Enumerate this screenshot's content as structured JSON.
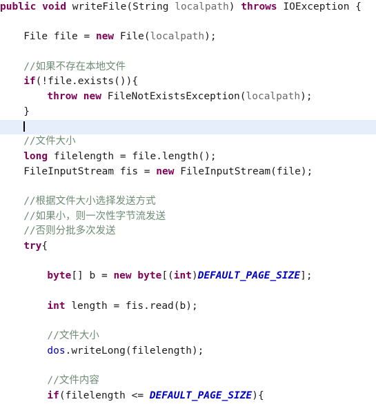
{
  "editor": {
    "language": "java",
    "theme": {
      "background": "#ffffff",
      "foreground": "#1a1a1a",
      "keyword": "#7f0055",
      "comment": "#6e8b74",
      "parameter": "#6a6a6a",
      "field": "#0000c0",
      "static_constant": "#0000c0",
      "current_line_highlight": "#e6eefb",
      "caret": "#000000"
    },
    "caret_line_index": 7,
    "lines": [
      {
        "indent": 0,
        "tokens": [
          {
            "t": "public",
            "c": "kw"
          },
          {
            "t": " ",
            "c": "plain"
          },
          {
            "t": "void",
            "c": "kw"
          },
          {
            "t": " ",
            "c": "plain"
          },
          {
            "t": "writeFile",
            "c": "plain"
          },
          {
            "t": "(",
            "c": "punc"
          },
          {
            "t": "String",
            "c": "plain"
          },
          {
            "t": " ",
            "c": "plain"
          },
          {
            "t": "localpath",
            "c": "param"
          },
          {
            "t": ") ",
            "c": "punc"
          },
          {
            "t": "throws",
            "c": "kw"
          },
          {
            "t": " ",
            "c": "plain"
          },
          {
            "t": "IOException",
            "c": "plain"
          },
          {
            "t": " {",
            "c": "punc"
          }
        ]
      },
      {
        "indent": 0,
        "tokens": []
      },
      {
        "indent": 4,
        "tokens": [
          {
            "t": "File",
            "c": "plain"
          },
          {
            "t": " ",
            "c": "plain"
          },
          {
            "t": "file",
            "c": "plain"
          },
          {
            "t": " = ",
            "c": "punc"
          },
          {
            "t": "new",
            "c": "kw"
          },
          {
            "t": " ",
            "c": "plain"
          },
          {
            "t": "File",
            "c": "plain"
          },
          {
            "t": "(",
            "c": "punc"
          },
          {
            "t": "localpath",
            "c": "param"
          },
          {
            "t": ");",
            "c": "punc"
          }
        ]
      },
      {
        "indent": 0,
        "tokens": []
      },
      {
        "indent": 4,
        "tokens": [
          {
            "t": "//如果不存在本地文件",
            "c": "cmt"
          }
        ]
      },
      {
        "indent": 4,
        "tokens": [
          {
            "t": "if",
            "c": "kw"
          },
          {
            "t": "(!",
            "c": "punc"
          },
          {
            "t": "file",
            "c": "plain"
          },
          {
            "t": ".",
            "c": "punc"
          },
          {
            "t": "exists",
            "c": "plain"
          },
          {
            "t": "()){",
            "c": "punc"
          }
        ]
      },
      {
        "indent": 8,
        "tokens": [
          {
            "t": "throw",
            "c": "kw"
          },
          {
            "t": " ",
            "c": "plain"
          },
          {
            "t": "new",
            "c": "kw"
          },
          {
            "t": " ",
            "c": "plain"
          },
          {
            "t": "FileNotExistsException",
            "c": "plain"
          },
          {
            "t": "(",
            "c": "punc"
          },
          {
            "t": "localpath",
            "c": "param"
          },
          {
            "t": ");",
            "c": "punc"
          }
        ]
      },
      {
        "indent": 4,
        "tokens": [
          {
            "t": "}",
            "c": "punc"
          }
        ]
      },
      {
        "indent": 4,
        "tokens": [],
        "caret": true
      },
      {
        "indent": 4,
        "tokens": [
          {
            "t": "//文件大小",
            "c": "cmt"
          }
        ]
      },
      {
        "indent": 4,
        "tokens": [
          {
            "t": "long",
            "c": "kw"
          },
          {
            "t": " ",
            "c": "plain"
          },
          {
            "t": "filelength",
            "c": "plain"
          },
          {
            "t": " = ",
            "c": "punc"
          },
          {
            "t": "file",
            "c": "plain"
          },
          {
            "t": ".",
            "c": "punc"
          },
          {
            "t": "length",
            "c": "plain"
          },
          {
            "t": "();",
            "c": "punc"
          }
        ]
      },
      {
        "indent": 4,
        "tokens": [
          {
            "t": "FileInputStream",
            "c": "plain"
          },
          {
            "t": " ",
            "c": "plain"
          },
          {
            "t": "fis",
            "c": "plain"
          },
          {
            "t": " = ",
            "c": "punc"
          },
          {
            "t": "new",
            "c": "kw"
          },
          {
            "t": " ",
            "c": "plain"
          },
          {
            "t": "FileInputStream",
            "c": "plain"
          },
          {
            "t": "(",
            "c": "punc"
          },
          {
            "t": "file",
            "c": "plain"
          },
          {
            "t": ");",
            "c": "punc"
          }
        ]
      },
      {
        "indent": 0,
        "tokens": []
      },
      {
        "indent": 4,
        "tokens": [
          {
            "t": "//根据文件大小选择发送方式",
            "c": "cmt"
          }
        ]
      },
      {
        "indent": 4,
        "tokens": [
          {
            "t": "//如果小，则一次性字节流发送",
            "c": "cmt"
          }
        ]
      },
      {
        "indent": 4,
        "tokens": [
          {
            "t": "//否则分批多次发送",
            "c": "cmt"
          }
        ]
      },
      {
        "indent": 4,
        "tokens": [
          {
            "t": "try",
            "c": "kw"
          },
          {
            "t": "{",
            "c": "punc"
          }
        ]
      },
      {
        "indent": 0,
        "tokens": []
      },
      {
        "indent": 8,
        "tokens": [
          {
            "t": "byte",
            "c": "kw"
          },
          {
            "t": "[] ",
            "c": "punc"
          },
          {
            "t": "b",
            "c": "plain"
          },
          {
            "t": " = ",
            "c": "punc"
          },
          {
            "t": "new",
            "c": "kw"
          },
          {
            "t": " ",
            "c": "plain"
          },
          {
            "t": "byte",
            "c": "kw"
          },
          {
            "t": "[(",
            "c": "punc"
          },
          {
            "t": "int",
            "c": "kw"
          },
          {
            "t": ")",
            "c": "punc"
          },
          {
            "t": "DEFAULT_PAGE_SIZE",
            "c": "const"
          },
          {
            "t": "];",
            "c": "punc"
          }
        ]
      },
      {
        "indent": 0,
        "tokens": []
      },
      {
        "indent": 8,
        "tokens": [
          {
            "t": "int",
            "c": "kw"
          },
          {
            "t": " ",
            "c": "plain"
          },
          {
            "t": "length",
            "c": "plain"
          },
          {
            "t": " = ",
            "c": "punc"
          },
          {
            "t": "fis",
            "c": "plain"
          },
          {
            "t": ".",
            "c": "punc"
          },
          {
            "t": "read",
            "c": "plain"
          },
          {
            "t": "(",
            "c": "punc"
          },
          {
            "t": "b",
            "c": "plain"
          },
          {
            "t": ");",
            "c": "punc"
          }
        ]
      },
      {
        "indent": 0,
        "tokens": []
      },
      {
        "indent": 8,
        "tokens": [
          {
            "t": "//文件大小",
            "c": "cmt"
          }
        ]
      },
      {
        "indent": 8,
        "tokens": [
          {
            "t": "dos",
            "c": "field"
          },
          {
            "t": ".",
            "c": "punc"
          },
          {
            "t": "writeLong",
            "c": "plain"
          },
          {
            "t": "(",
            "c": "punc"
          },
          {
            "t": "filelength",
            "c": "plain"
          },
          {
            "t": ");",
            "c": "punc"
          }
        ]
      },
      {
        "indent": 0,
        "tokens": []
      },
      {
        "indent": 8,
        "tokens": [
          {
            "t": "//文件内容",
            "c": "cmt"
          }
        ]
      },
      {
        "indent": 8,
        "tokens": [
          {
            "t": "if",
            "c": "kw"
          },
          {
            "t": "(",
            "c": "punc"
          },
          {
            "t": "filelength",
            "c": "plain"
          },
          {
            "t": " <= ",
            "c": "punc"
          },
          {
            "t": "DEFAULT_PAGE_SIZE",
            "c": "const"
          },
          {
            "t": "){",
            "c": "punc"
          }
        ]
      }
    ]
  }
}
